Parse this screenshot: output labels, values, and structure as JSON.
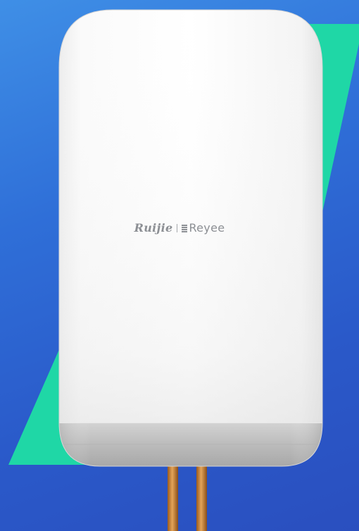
{
  "logo": {
    "brand_primary": "Ruijie",
    "brand_secondary": "Reyee"
  },
  "colors": {
    "background": "#2f6fd8",
    "accent_stripe": "#1fd7a6",
    "device_body": "#f7f7f7",
    "device_base": "#c2c2c2",
    "cable": "#d08a3a"
  }
}
